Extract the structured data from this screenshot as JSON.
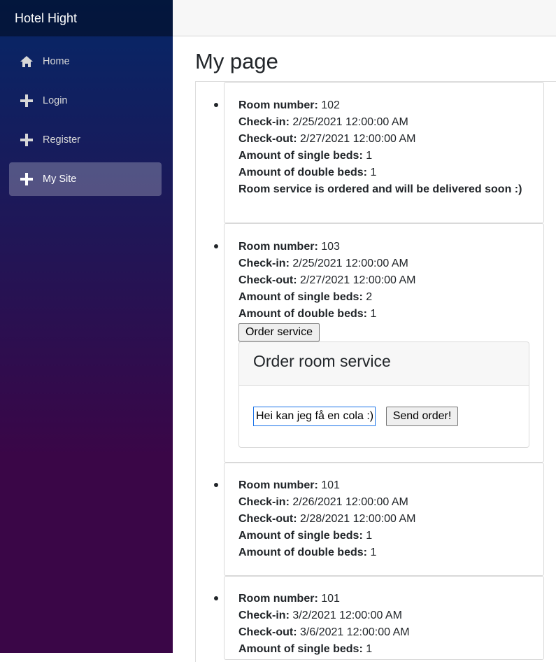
{
  "app": {
    "brand": "Hotel Hight"
  },
  "nav": [
    {
      "label": "Home",
      "icon": "home-icon",
      "active": false
    },
    {
      "label": "Login",
      "icon": "plus-icon",
      "active": false
    },
    {
      "label": "Register",
      "icon": "plus-icon",
      "active": false
    },
    {
      "label": "My Site",
      "icon": "plus-icon",
      "active": true
    }
  ],
  "page": {
    "title": "My page"
  },
  "labels": {
    "room_number": "Room number:",
    "check_in": "Check-in:",
    "check_out": "Check-out:",
    "single_beds": "Amount of single beds:",
    "double_beds": "Amount of double beds:"
  },
  "bookings": [
    {
      "room_number": "102",
      "check_in": "2/25/2021 12:00:00 AM",
      "check_out": "2/27/2021 12:00:00 AM",
      "single_beds": "1",
      "double_beds": "1",
      "status": "Room service is ordered and will be delivered soon :)"
    },
    {
      "room_number": "103",
      "check_in": "2/25/2021 12:00:00 AM",
      "check_out": "2/27/2021 12:00:00 AM",
      "single_beds": "2",
      "double_beds": "1",
      "order_button": "Order service",
      "order_panel": {
        "title": "Order room service",
        "input_value": "Hei kan jeg få en cola :)",
        "send_button": "Send order!"
      }
    },
    {
      "room_number": "101",
      "check_in": "2/26/2021 12:00:00 AM",
      "check_out": "2/28/2021 12:00:00 AM",
      "single_beds": "1",
      "double_beds": "1"
    },
    {
      "room_number": "101",
      "check_in": "3/2/2021 12:00:00 AM",
      "check_out": "3/6/2021 12:00:00 AM",
      "single_beds": "1"
    }
  ]
}
